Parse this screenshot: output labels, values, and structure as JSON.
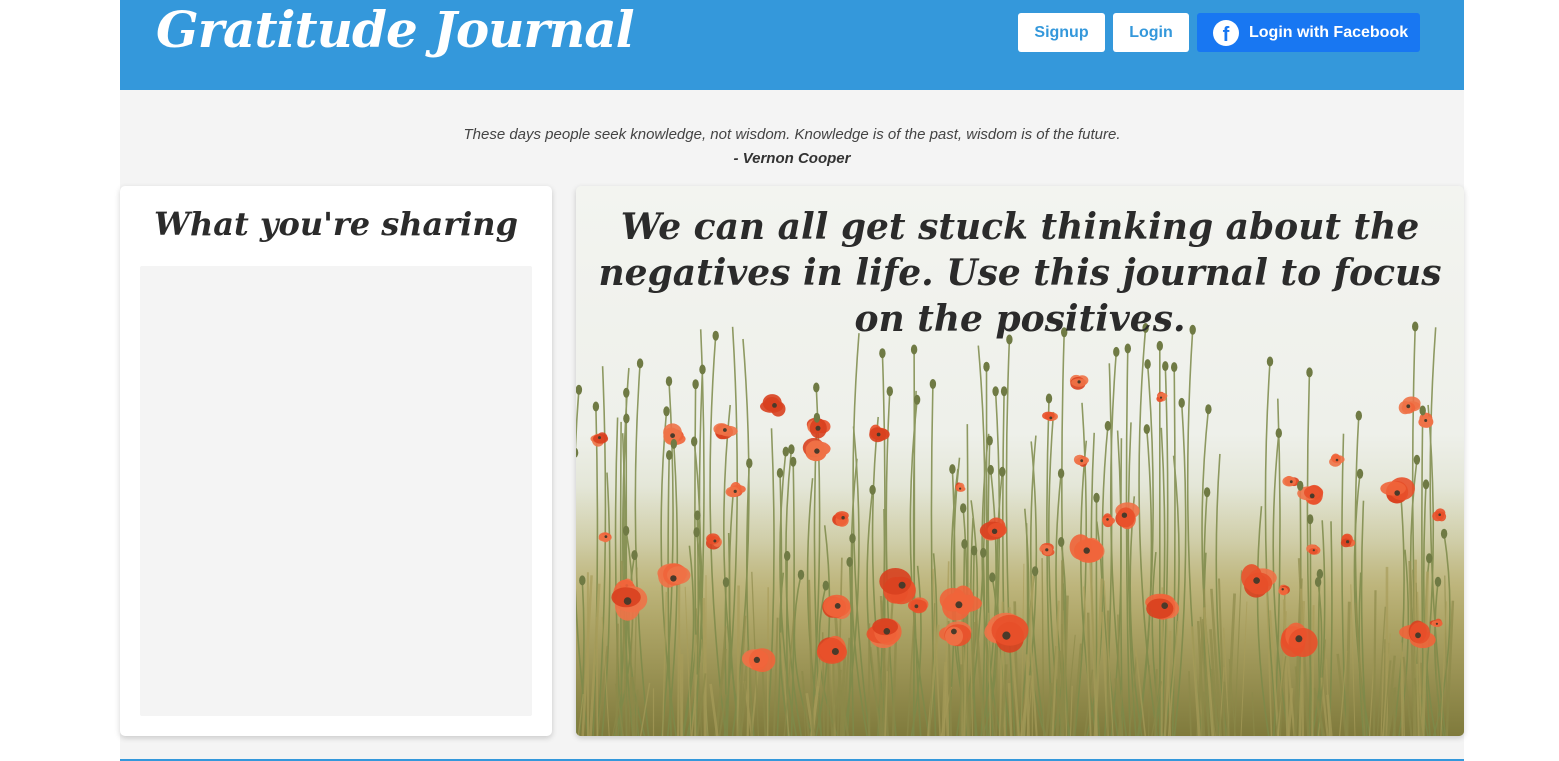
{
  "header": {
    "brand": "Gratitude Journal",
    "signup_label": "Signup",
    "login_label": "Login",
    "facebook_label": "Login with Facebook",
    "facebook_icon": "f",
    "background_color": "#3498db"
  },
  "quote": {
    "text": "These days people seek knowledge, not wisdom. Knowledge is of the past, wisdom is of the future.",
    "author": "- Vernon Cooper"
  },
  "sharing": {
    "title": "What you're sharing"
  },
  "hero": {
    "headline": "We can all get stuck thinking about the negatives in life. Use this journal to focus on the positives.",
    "image_icon": "poppy-field-image"
  }
}
